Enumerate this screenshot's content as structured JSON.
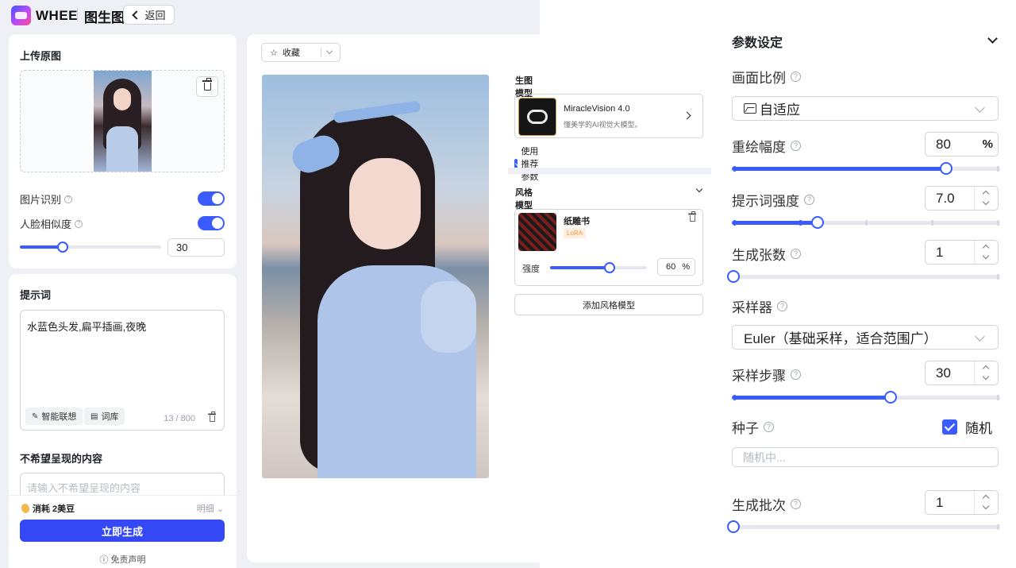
{
  "topbar": {
    "logo_text": "WHEE",
    "page_name": "图生图",
    "back_label": "返回"
  },
  "upload": {
    "title": "上传原图",
    "image_recognition_label": "图片识别",
    "image_recognition_on": true,
    "face_similarity_label": "人脸相似度",
    "face_similarity_on": true,
    "face_similarity_value": "30"
  },
  "prompt": {
    "title": "提示词",
    "text": "水蓝色头发,扁平插画,夜晚",
    "smart_assoc_label": "智能联想",
    "lexicon_label": "词库",
    "counter": "13 / 800"
  },
  "negative": {
    "title": "不希望呈现的内容",
    "placeholder": "请输入不希望呈现的内容"
  },
  "footer": {
    "cost_label": "消耗 2美豆",
    "detail_label": "明细",
    "generate_label": "立即生成",
    "disclaimer_label": "免责声明"
  },
  "canvas": {
    "favorite_label": "收藏"
  },
  "gen_model": {
    "section_label": "生图模型",
    "name": "MiracleVision 4.0",
    "desc": "懂美学的AI视觉大模型。",
    "use_recommended_label": "使用推荐参数"
  },
  "style_model": {
    "section_label": "风格模型",
    "name": "纸雕书",
    "tag": "LoRA",
    "strength_label": "强度",
    "strength_value": "60",
    "strength_unit": "%",
    "add_label": "添加风格模型"
  },
  "params": {
    "title": "参数设定",
    "aspect_label": "画面比例",
    "aspect_value": "自适应",
    "redraw_label": "重绘幅度",
    "redraw_value": "80",
    "redraw_unit": "%",
    "redraw_fraction": 0.8,
    "prompt_strength_label": "提示词强度",
    "prompt_strength_value": "7.0",
    "count_label": "生成张数",
    "count_value": "1",
    "sampler_label": "采样器",
    "sampler_value": "Euler（基础采样，适合范围广）",
    "steps_label": "采样步骤",
    "steps_value": "30",
    "seed_label": "种子",
    "random_label": "随机",
    "random_checked": true,
    "seed_placeholder": "随机中...",
    "batch_label": "生成批次",
    "batch_value": "1"
  },
  "colors": {
    "accent": "#3a5cff",
    "generate_button": "#3548f5",
    "lora_tag": "#e99b4a"
  },
  "icons": [
    "logo-icon",
    "chevron-left-icon",
    "trash-icon",
    "help-icon",
    "edit-icon",
    "book-icon",
    "bean-icon",
    "chevron-down-icon",
    "info-icon",
    "star-icon",
    "chevron-right-icon",
    "checkbox-icon",
    "image-icon",
    "stepper-icon"
  ]
}
